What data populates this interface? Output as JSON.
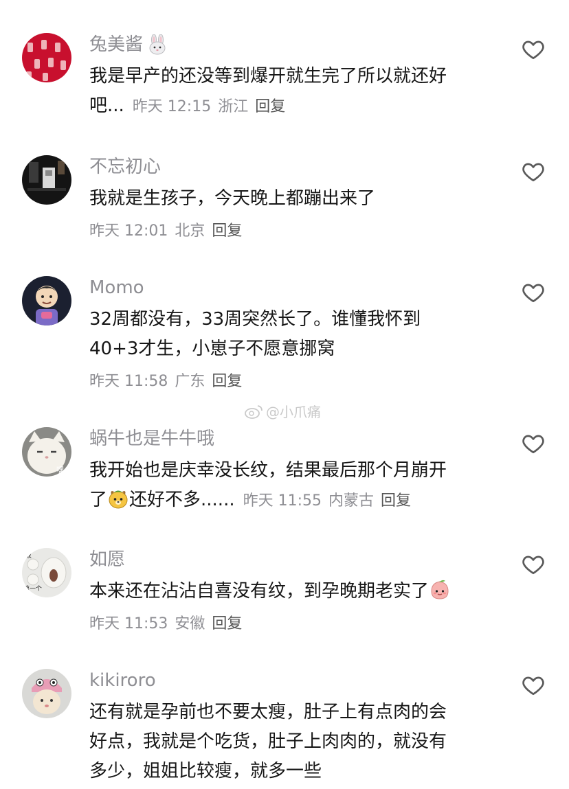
{
  "comments": [
    {
      "username": "兔美酱",
      "text_lines": [
        "我是早产的还没等到爆开就生完了所以就还好",
        "吧..."
      ],
      "time": "昨天 12:15",
      "location": "浙江",
      "reply_label": "回复"
    },
    {
      "username": "不忘初心",
      "text_lines": [
        "我就是生孩子，今天晚上都蹦出来了"
      ],
      "time": "昨天 12:01",
      "location": "北京",
      "reply_label": "回复"
    },
    {
      "username": "Momo",
      "text_lines": [
        "32周都没有，33周突然长了。谁懂我怀到",
        "40+3才生，小崽子不愿意挪窝"
      ],
      "time": "昨天 11:58",
      "location": "广东",
      "reply_label": "回复"
    },
    {
      "username": "蜗牛也是牛牛哦",
      "text_lines": [
        "我开始也是庆幸没长纹，结果最后那个月崩开",
        "了",
        "还好不多......"
      ],
      "time": "昨天 11:55",
      "location": "内蒙古",
      "reply_label": "回复"
    },
    {
      "username": "如愿",
      "text_lines": [
        "本来还在沾沾自喜没有纹，到孕晚期老实了"
      ],
      "time": "昨天 11:53",
      "location": "安徽",
      "reply_label": "回复"
    },
    {
      "username": "kikiroro",
      "text_lines": [
        "还有就是孕前也不要太瘦，肚子上有点肉的会",
        "好点，我就是个吃货，肚子上肉肉的，就没有",
        "多少，姐姐比较瘦，就多一些"
      ]
    }
  ],
  "avatar_texts": {
    "c4": "嘿",
    "c5a": "敢",
    "c5b": "第一个"
  },
  "watermark": "@小爪痛",
  "colors": {
    "meta": "#8e8e93",
    "text": "#161616",
    "heart": "#5a5a5a"
  },
  "icons": [
    "heart-outline-icon",
    "rabbit-emoji-icon",
    "dog-emoji-icon",
    "peach-emoji-icon",
    "weibo-logo-icon"
  ]
}
